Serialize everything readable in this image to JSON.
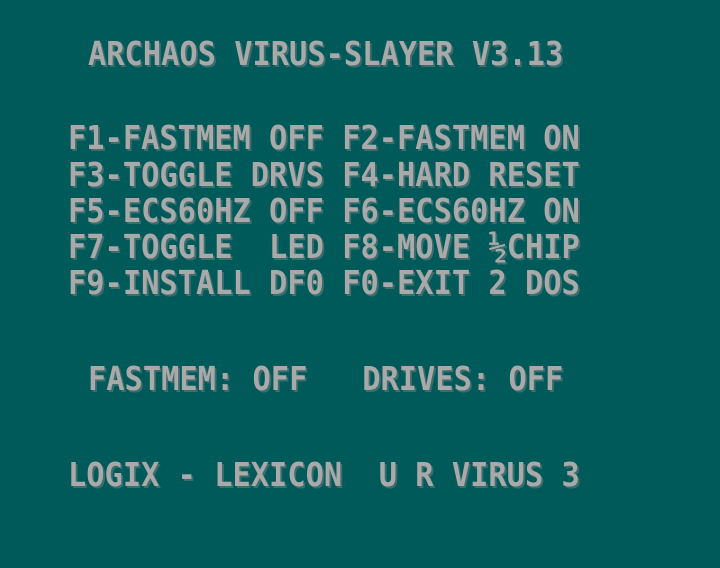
{
  "title": "ARCHAOS VIRUS-SLAYER V3.13",
  "menu": [
    {
      "left": {
        "label": "F1-FASTMEM OFF"
      },
      "right": {
        "label": "F2-FASTMEM ON"
      }
    },
    {
      "left": {
        "label": "F3-TOGGLE DRVS"
      },
      "right": {
        "label": "F4-HARD RESET"
      }
    },
    {
      "left": {
        "label": "F5-ECS60HZ OFF"
      },
      "right": {
        "label": "F6-ECS60HZ ON"
      }
    },
    {
      "left": {
        "label": "F7-TOGGLE  LED"
      },
      "right": {
        "label": "F8-MOVE ½CHIP"
      }
    },
    {
      "left": {
        "label": "F9-INSTALL DF0"
      },
      "right": {
        "label": "F0-EXIT 2 DOS"
      }
    }
  ],
  "status": {
    "fastmem_label": "FASTMEM:",
    "fastmem_value": "OFF",
    "drives_label": "DRIVES:",
    "drives_value": "OFF"
  },
  "footer": "LOGIX - LEXICON  U R VIRUS 3",
  "colors": {
    "background": "#005a5a",
    "text": "#a9a9a9"
  }
}
